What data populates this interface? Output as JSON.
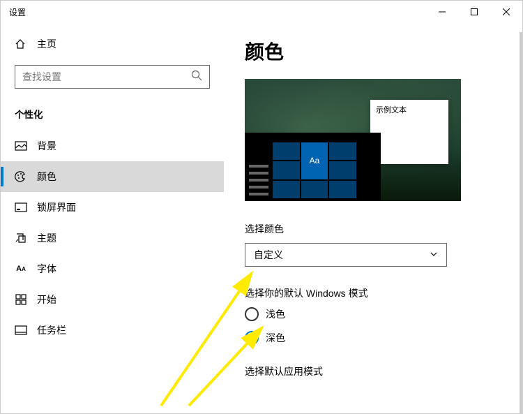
{
  "window": {
    "title": "设置"
  },
  "sidebar": {
    "home": "主页",
    "search_placeholder": "查找设置",
    "section": "个性化",
    "items": [
      {
        "label": "背景"
      },
      {
        "label": "颜色"
      },
      {
        "label": "锁屏界面"
      },
      {
        "label": "主题"
      },
      {
        "label": "字体"
      },
      {
        "label": "开始"
      },
      {
        "label": "任务栏"
      }
    ]
  },
  "main": {
    "title": "颜色",
    "preview_sample_text": "示例文本",
    "preview_tile_text": "Aa",
    "color_choice_label": "选择颜色",
    "color_choice_value": "自定义",
    "win_mode_label": "选择你的默认 Windows 模式",
    "win_mode_light": "浅色",
    "win_mode_dark": "深色",
    "app_mode_label": "选择默认应用模式"
  },
  "colors": {
    "accent": "#0078d4",
    "tile_dark": "#003e6e",
    "tile_accent": "#0063b1",
    "arrow": "#ffeb00"
  }
}
